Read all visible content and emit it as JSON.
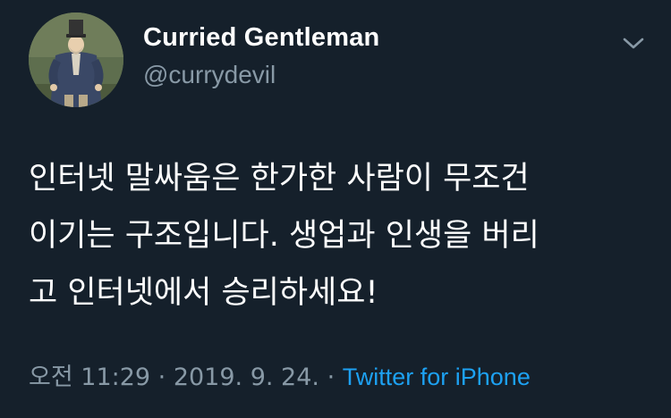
{
  "user": {
    "display_name": "Curried Gentleman",
    "handle": "@currydevil",
    "avatar": "avatar-portrait-gentleman-in-top-hat"
  },
  "menu": {
    "icon": "chevron-down-icon"
  },
  "tweet": {
    "text": "인터넷 말싸움은 한가한 사람이 무조건\n이기는 구조입니다. 생업과 인생을 버리\n고 인터넷에서 승리하세요!"
  },
  "meta": {
    "time": "오전 11:29",
    "separator": " · ",
    "date": "2019. 9. 24.",
    "source": "Twitter for iPhone"
  },
  "colors": {
    "background": "#15202b",
    "text": "#ffffff",
    "secondary": "#8899a6",
    "link": "#1da1f2"
  }
}
